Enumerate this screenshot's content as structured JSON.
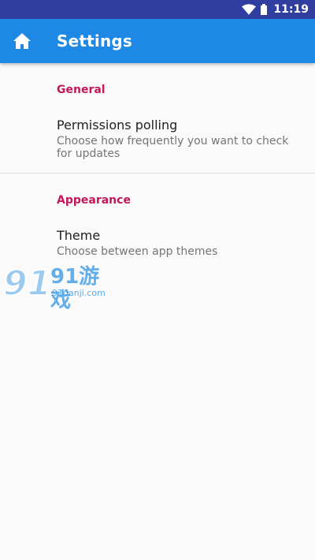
{
  "status_bar": {
    "time": "11:19"
  },
  "toolbar": {
    "title": "Settings",
    "home_icon": "home-icon"
  },
  "sections": [
    {
      "header": "General",
      "items": [
        {
          "title": "Permissions polling",
          "summary": "Choose how frequently you want to check for updates"
        }
      ]
    },
    {
      "header": "Appearance",
      "items": [
        {
          "title": "Theme",
          "summary": "Choose between app themes"
        }
      ]
    }
  ],
  "watermark": {
    "logo_text": "91游戏",
    "site": "91danji.com"
  },
  "colors": {
    "status_bar": "#303f9f",
    "toolbar": "#1e88e5",
    "section_header": "#c2185b",
    "background": "#fafafa"
  }
}
